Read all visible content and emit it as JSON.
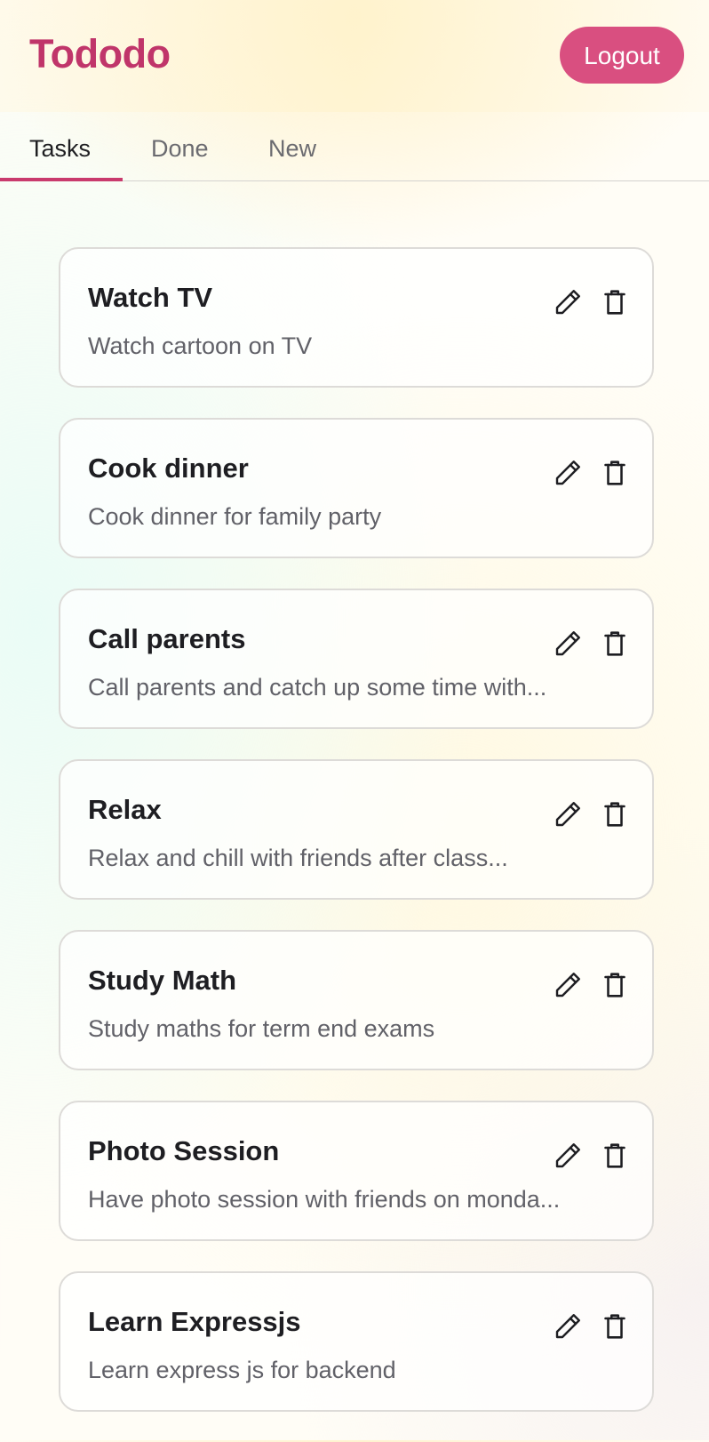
{
  "app": {
    "title": "Tododo"
  },
  "header": {
    "logout_label": "Logout"
  },
  "tabs": [
    {
      "label": "Tasks",
      "active": true
    },
    {
      "label": "Done",
      "active": false
    },
    {
      "label": "New",
      "active": false
    }
  ],
  "tasks": [
    {
      "title": "Watch TV",
      "description": "Watch cartoon on TV"
    },
    {
      "title": "Cook dinner",
      "description": "Cook dinner for family party"
    },
    {
      "title": "Call parents",
      "description": "Call parents and catch up some time with..."
    },
    {
      "title": "Relax",
      "description": "Relax and chill with friends after class..."
    },
    {
      "title": "Study Math",
      "description": "Study maths for term end exams"
    },
    {
      "title": "Photo Session",
      "description": "Have photo session with friends on monda..."
    },
    {
      "title": "Learn Expressjs",
      "description": "Learn express js for backend"
    }
  ],
  "icons": {
    "edit": "pencil-icon",
    "delete": "trash-icon"
  },
  "colors": {
    "brand": "#c0356a",
    "logout_bg": "#d94f80",
    "tab_indicator": "#c93a6d"
  }
}
